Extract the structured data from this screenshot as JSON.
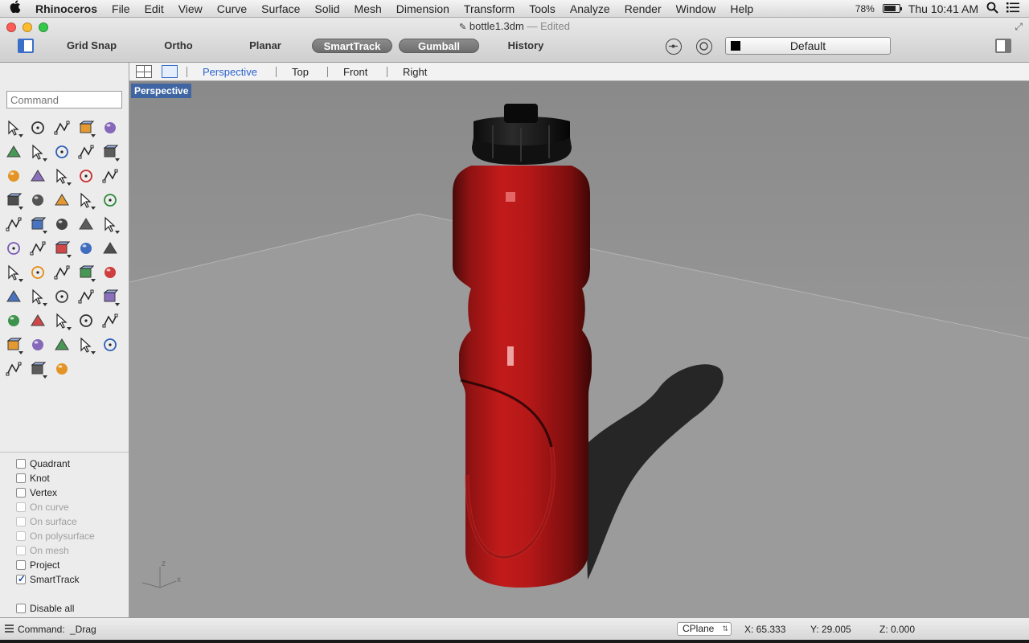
{
  "menubar": {
    "apple_icon": "apple-logo-icon",
    "app_name": "Rhinoceros",
    "items": [
      "File",
      "Edit",
      "View",
      "Curve",
      "Surface",
      "Solid",
      "Mesh",
      "Dimension",
      "Transform",
      "Tools",
      "Analyze",
      "Render",
      "Window",
      "Help"
    ],
    "battery_percent": "78%",
    "battery_level": 0.78,
    "clock": "Thu 10:41 AM"
  },
  "window": {
    "title": "bottle1.3dm",
    "status": "— Edited"
  },
  "toolbar": {
    "grid_snap": "Grid Snap",
    "ortho": "Ortho",
    "planar": "Planar",
    "smarttrack": "SmartTrack",
    "gumball": "Gumball",
    "history": "History",
    "layer": "Default",
    "layer_color": "#000000"
  },
  "command": {
    "placeholder": "Command"
  },
  "tools": [
    "select-arrow-icon",
    "point-icon",
    "polyline-icon",
    "curve-icon",
    "circle-icon",
    "ellipse-icon",
    "arc-icon",
    "rectangle-icon",
    "polygon-icon",
    "fillet-curve-icon",
    "surface-from-points-icon",
    "extrude-surface-icon",
    "box-icon",
    "sphere-icon",
    "cylinder-icon",
    "plane-surface-icon",
    "explode-icon",
    "trim-icon",
    "split-icon",
    "join-icon",
    "boolean-union-icon",
    "group-icon",
    "fillet-edge-icon",
    "rebuild-icon",
    "text-icon",
    "transform-icon",
    "array-icon",
    "mirror-icon",
    "solid-edit-icon",
    "dimension-icon",
    "grid-array-icon",
    "layer-icon",
    "properties-icon",
    "check-icon",
    "analyze-mesh-icon",
    "paint-icon",
    "zoom-icon",
    "zoom-window-icon",
    "zoom-extents-icon",
    "zoom-selected-icon",
    "rotate-view-icon",
    "car-render-icon",
    "material-icon",
    "lights-icon",
    "light-bulb-icon",
    "lock-icon",
    "layer-color-icon",
    "color-wheel-icon",
    "wireframe-sphere-icon",
    "shaded-sphere-icon",
    "render-sphere-icon",
    "cone-icon",
    "cplane-icon"
  ],
  "osnaps": [
    {
      "label": "Quadrant",
      "checked": false,
      "enabled": true
    },
    {
      "label": "Knot",
      "checked": false,
      "enabled": true
    },
    {
      "label": "Vertex",
      "checked": false,
      "enabled": true
    },
    {
      "label": "On curve",
      "checked": false,
      "enabled": false
    },
    {
      "label": "On surface",
      "checked": false,
      "enabled": false
    },
    {
      "label": "On polysurface",
      "checked": false,
      "enabled": false
    },
    {
      "label": "On mesh",
      "checked": false,
      "enabled": false
    },
    {
      "label": "Project",
      "checked": false,
      "enabled": true
    },
    {
      "label": "SmartTrack",
      "checked": true,
      "enabled": true
    }
  ],
  "disable_all": "Disable all",
  "viewtabs": {
    "tabs": [
      "Perspective",
      "Top",
      "Front",
      "Right"
    ],
    "active": "Perspective"
  },
  "viewport": {
    "label": "Perspective",
    "axis_x": "x",
    "axis_z": "z",
    "bottle_color": "#b01818",
    "cap_color": "#151515"
  },
  "status": {
    "command_label": "Command:",
    "command_value": "_Drag",
    "cplane": "CPlane",
    "x": "X: 65.333",
    "y": "Y: 29.005",
    "z": "Z: 0.000"
  }
}
